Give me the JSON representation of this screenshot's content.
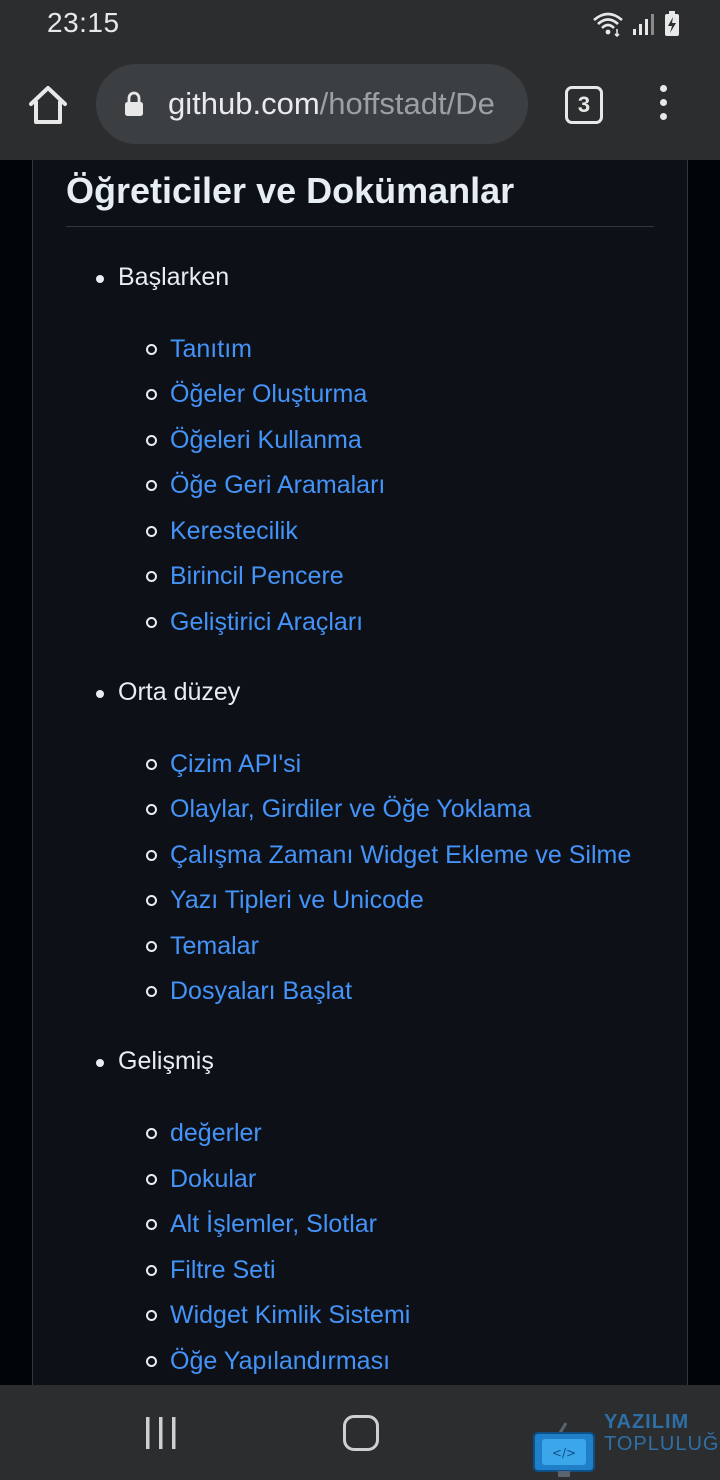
{
  "status_bar": {
    "time": "23:15",
    "icons": [
      "wifi-icon",
      "signal-icon",
      "battery-icon"
    ]
  },
  "browser": {
    "url_domain": "github.com",
    "url_path": "/hoffstadt/De",
    "tab_count": "3",
    "icons": [
      "home-icon",
      "lock-icon",
      "more-vert-icon"
    ]
  },
  "page": {
    "heading": "Öğreticiler ve Dokümanlar",
    "sections": [
      {
        "title": "Başlarken",
        "links": [
          "Tanıtım",
          "Öğeler Oluşturma",
          "Öğeleri Kullanma",
          "Öğe Geri Aramaları",
          "Kerestecilik",
          "Birincil Pencere",
          "Geliştirici Araçları"
        ]
      },
      {
        "title": "Orta düzey",
        "links": [
          "Çizim API'si",
          "Olaylar, Girdiler ve Öğe Yoklama",
          "Çalışma Zamanı Widget Ekleme ve Silme",
          "Yazı Tipleri ve Unicode",
          "Temalar",
          "Dosyaları Başlat"
        ]
      },
      {
        "title": "Gelişmiş",
        "links": [
          "değerler",
          "Dokular",
          "Alt İşlemler, Slotlar",
          "Filtre Seti",
          "Widget Kimlik Sistemi",
          "Öğe Yapılandırması"
        ]
      }
    ]
  },
  "watermark": {
    "line1": "YAZILIM",
    "line2": "TOPLULUĞU"
  },
  "colors": {
    "link": "#4493f8",
    "page_bg": "#0d1117",
    "chrome_bg": "#2b2d2f",
    "text": "#e6edf3"
  }
}
